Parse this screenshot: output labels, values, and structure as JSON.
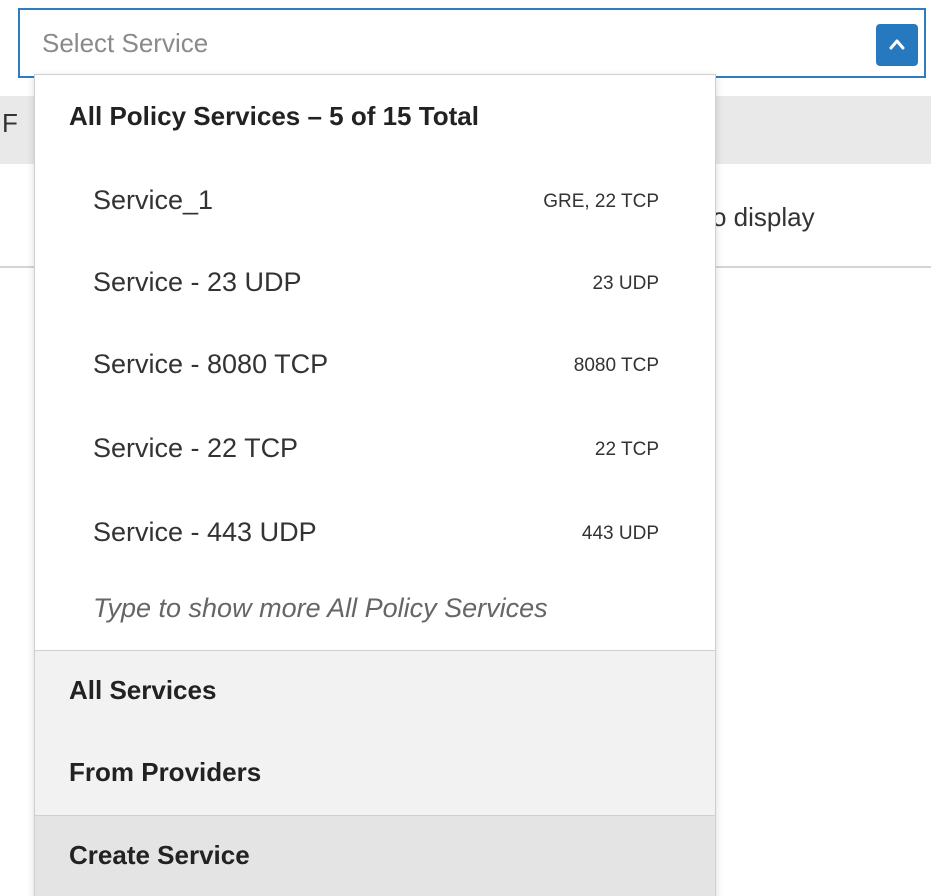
{
  "background": {
    "header_letter": "F",
    "empty_text": "o display"
  },
  "select": {
    "placeholder": "Select Service",
    "toggle_icon": "chevron-up-icon",
    "accent_color": "#2779bf"
  },
  "dropdown": {
    "group_header": "All Policy Services – 5 of 15 Total",
    "options": [
      {
        "label": "Service_1",
        "meta": "GRE, 22 TCP"
      },
      {
        "label": "Service - 23 UDP",
        "meta": "23 UDP"
      },
      {
        "label": "Service - 8080 TCP",
        "meta": "8080 TCP"
      },
      {
        "label": "Service - 22 TCP",
        "meta": "22 TCP"
      },
      {
        "label": "Service - 443 UDP",
        "meta": "443 UDP"
      }
    ],
    "more_hint": "Type to show more All Policy Services",
    "sections": [
      {
        "label": "All Services"
      },
      {
        "label": "From Providers"
      }
    ],
    "create_label": "Create Service"
  }
}
